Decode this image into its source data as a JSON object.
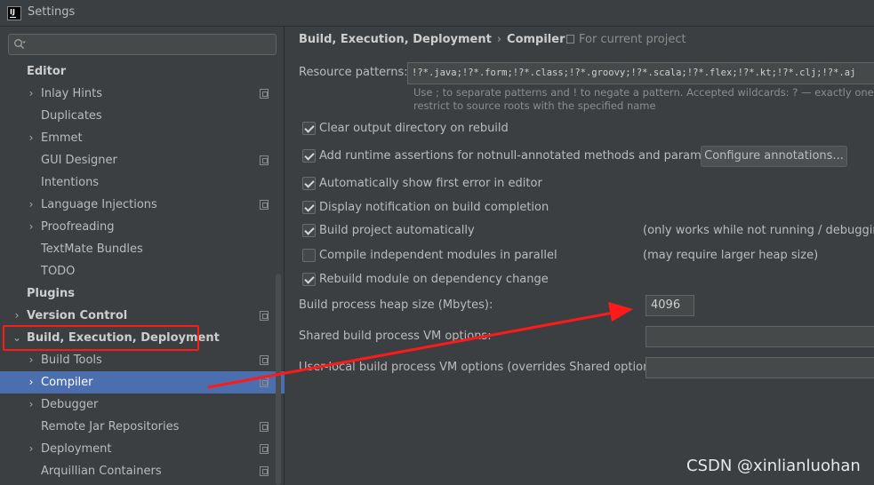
{
  "window": {
    "title": "Settings"
  },
  "search": {
    "placeholder": "",
    "value": ""
  },
  "sidebar": {
    "items": [
      {
        "label": "Editor",
        "type": "section",
        "level": 0,
        "arrow": "",
        "icon": false,
        "selected": false
      },
      {
        "label": "Inlay Hints",
        "type": "item",
        "level": 1,
        "arrow": "›",
        "icon": true,
        "selected": false
      },
      {
        "label": "Duplicates",
        "type": "item",
        "level": 1,
        "arrow": "",
        "icon": false,
        "selected": false
      },
      {
        "label": "Emmet",
        "type": "item",
        "level": 1,
        "arrow": "›",
        "icon": false,
        "selected": false
      },
      {
        "label": "GUI Designer",
        "type": "item",
        "level": 1,
        "arrow": "",
        "icon": true,
        "selected": false
      },
      {
        "label": "Intentions",
        "type": "item",
        "level": 1,
        "arrow": "",
        "icon": false,
        "selected": false
      },
      {
        "label": "Language Injections",
        "type": "item",
        "level": 1,
        "arrow": "›",
        "icon": true,
        "selected": false
      },
      {
        "label": "Proofreading",
        "type": "item",
        "level": 1,
        "arrow": "›",
        "icon": false,
        "selected": false
      },
      {
        "label": "TextMate Bundles",
        "type": "item",
        "level": 1,
        "arrow": "",
        "icon": false,
        "selected": false
      },
      {
        "label": "TODO",
        "type": "item",
        "level": 1,
        "arrow": "",
        "icon": false,
        "selected": false
      },
      {
        "label": "Plugins",
        "type": "section",
        "level": 0,
        "arrow": "",
        "icon": false,
        "selected": false
      },
      {
        "label": "Version Control",
        "type": "section",
        "level": 0,
        "arrow": "›",
        "icon": true,
        "selected": false
      },
      {
        "label": "Build, Execution, Deployment",
        "type": "section",
        "level": 0,
        "arrow": "⌄",
        "icon": false,
        "selected": false
      },
      {
        "label": "Build Tools",
        "type": "item",
        "level": 1,
        "arrow": "›",
        "icon": true,
        "selected": false
      },
      {
        "label": "Compiler",
        "type": "item",
        "level": 1,
        "arrow": "›",
        "icon": true,
        "selected": true
      },
      {
        "label": "Debugger",
        "type": "item",
        "level": 1,
        "arrow": "›",
        "icon": false,
        "selected": false
      },
      {
        "label": "Remote Jar Repositories",
        "type": "item",
        "level": 1,
        "arrow": "",
        "icon": true,
        "selected": false
      },
      {
        "label": "Deployment",
        "type": "item",
        "level": 1,
        "arrow": "›",
        "icon": true,
        "selected": false
      },
      {
        "label": "Arquillian Containers",
        "type": "item",
        "level": 1,
        "arrow": "",
        "icon": true,
        "selected": false
      }
    ]
  },
  "main": {
    "breadcrumb": {
      "parent": "Build, Execution, Deployment",
      "separator": "›",
      "current": "Compiler"
    },
    "scope_label": "For current project",
    "resource_patterns": {
      "label": "Resource patterns:",
      "value": "!?*.java;!?*.form;!?*.class;!?*.groovy;!?*.scala;!?*.flex;!?*.kt;!?*.clj;!?*.aj",
      "hint_line1": "Use ; to separate patterns and ! to negate a pattern. Accepted wildcards: ? — exactly one symbol; *",
      "hint_line2": "restrict to source roots with the specified name"
    },
    "options": [
      {
        "label": "Clear output directory on rebuild",
        "checked": true,
        "note": ""
      },
      {
        "label": "Add runtime assertions for notnull-annotated methods and parameters",
        "checked": true,
        "note": ""
      },
      {
        "label": "Automatically show first error in editor",
        "checked": true,
        "note": ""
      },
      {
        "label": "Display notification on build completion",
        "checked": true,
        "note": ""
      },
      {
        "label": "Build project automatically",
        "checked": true,
        "note": "(only works while not running / debugging)"
      },
      {
        "label": "Compile independent modules in parallel",
        "checked": false,
        "note": "(may require larger heap size)"
      },
      {
        "label": "Rebuild module on dependency change",
        "checked": true,
        "note": ""
      }
    ],
    "configure_button": "Configure annotations...",
    "heap": {
      "label": "Build process heap size (Mbytes):",
      "value": "4096"
    },
    "shared_vm": {
      "label": "Shared build process VM options:",
      "value": ""
    },
    "user_vm": {
      "label": "User-local build process VM options (overrides Shared options):",
      "value": ""
    }
  },
  "watermark": "CSDN @xinlianluohan",
  "colors": {
    "background": "#3c3f41",
    "selection": "#4b6eaf",
    "annotation": "#ff1a1a"
  }
}
